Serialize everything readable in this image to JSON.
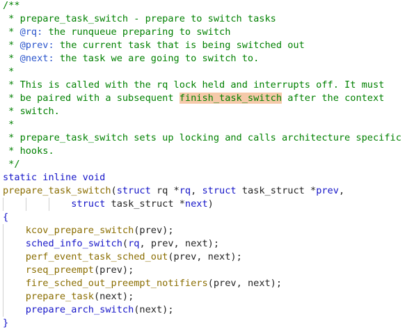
{
  "editor": {
    "comment": {
      "open": "/**",
      "l1_star": " * ",
      "l1_text": "prepare_task_switch - prepare to switch tasks",
      "l2_tag": "@rq:",
      "l2_text": " the runqueue preparing to switch",
      "l3_tag": "@prev:",
      "l3_text": " the current task that is being switched out",
      "l4_tag": "@next:",
      "l4_text": " the task we are going to switch to.",
      "blank": " *",
      "l6_text": "This is called with the rq lock held and interrupts off. It must",
      "l7_pre": "be paired with a subsequent ",
      "l7_hl": "finish_task_switch",
      "l7_post": " after the context",
      "l8_text": "switch.",
      "l10_text": "prepare_task_switch sets up locking and calls architecture specific",
      "l11_text": "hooks.",
      "close": " */"
    },
    "signature": {
      "qualifiers": "static inline void",
      "name": "prepare_task_switch",
      "open_paren": "(",
      "struct_kw": "struct",
      "rq_type": "rq",
      "star": " *",
      "rq_param": "rq",
      "comma": ", ",
      "task_struct": "task_struct",
      "prev_param": "prev",
      "next_param": "next",
      "close_paren": ")"
    },
    "body": {
      "open_brace": "{",
      "close_brace": "}",
      "calls": [
        {
          "name": "kcov_prepare_switch",
          "args": "(prev);"
        },
        {
          "name": "sched_info_switch",
          "args_pre": "(",
          "arg1": "rq",
          "args_post": ", prev, next);"
        },
        {
          "name": "perf_event_task_sched_out",
          "args": "(prev, next);"
        },
        {
          "name": "rseq_preempt",
          "args": "(prev);"
        },
        {
          "name": "fire_sched_out_preempt_notifiers",
          "args": "(prev, next);"
        },
        {
          "name": "prepare_task",
          "args": "(next);"
        },
        {
          "name": "prepare_arch_switch",
          "args": "(next);"
        }
      ]
    }
  }
}
